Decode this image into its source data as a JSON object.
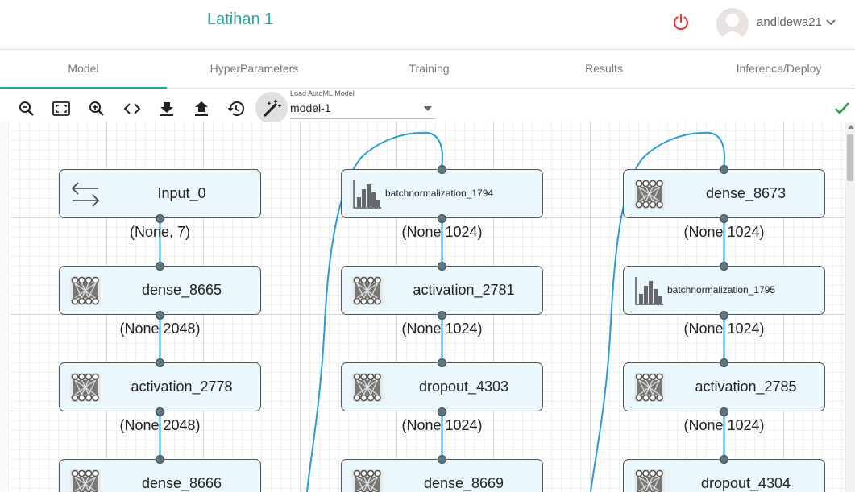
{
  "header": {
    "project_title": "Latihan 1",
    "username": "andidewa21",
    "power_icon": "power-icon",
    "accent_color": "#26a69a"
  },
  "tabs": [
    {
      "label": "Model",
      "active": true
    },
    {
      "label": "HyperParameters",
      "active": false
    },
    {
      "label": "Training",
      "active": false
    },
    {
      "label": "Results",
      "active": false
    },
    {
      "label": "Inference/Deploy",
      "active": false
    }
  ],
  "toolbar": {
    "icons": [
      "zoom-out-icon",
      "fit-screen-icon",
      "zoom-in-icon",
      "code-icon",
      "download-icon",
      "upload-icon",
      "history-icon"
    ],
    "automl_label": "Load AutoML Model",
    "automl_value": "model-1",
    "status_icon": "check-icon"
  },
  "graph": {
    "columns": [
      {
        "nodes": [
          {
            "label": "Input_0",
            "icon": "swap-arrows-icon",
            "shape": "(None, 7)"
          },
          {
            "label": "dense_8665",
            "icon": "dense-layer-icon",
            "shape": "(None  2048)"
          },
          {
            "label": "activation_2778",
            "icon": "dense-layer-icon",
            "shape": "(None  2048)"
          },
          {
            "label": "dense_8666",
            "icon": "dense-layer-icon"
          }
        ]
      },
      {
        "nodes": [
          {
            "label": "batchnormalization_1794",
            "icon": "histogram-icon",
            "shape": "(None  1024)"
          },
          {
            "label": "activation_2781",
            "icon": "dense-layer-icon",
            "shape": "(None  1024)"
          },
          {
            "label": "dropout_4303",
            "icon": "dense-layer-icon",
            "shape": "(None  1024)"
          },
          {
            "label": "dense_8669",
            "icon": "dense-layer-icon"
          }
        ]
      },
      {
        "nodes": [
          {
            "label": "dense_8673",
            "icon": "dense-layer-icon",
            "shape": "(None  1024)"
          },
          {
            "label": "batchnormalization_1795",
            "icon": "histogram-icon",
            "shape": "(None  1024)"
          },
          {
            "label": "activation_2785",
            "icon": "dense-layer-icon",
            "shape": "(None  1024)"
          },
          {
            "label": "dropout_4304",
            "icon": "dense-layer-icon"
          }
        ]
      }
    ],
    "wire_color": "#2b9bd6",
    "port_color": "#5f7780"
  }
}
